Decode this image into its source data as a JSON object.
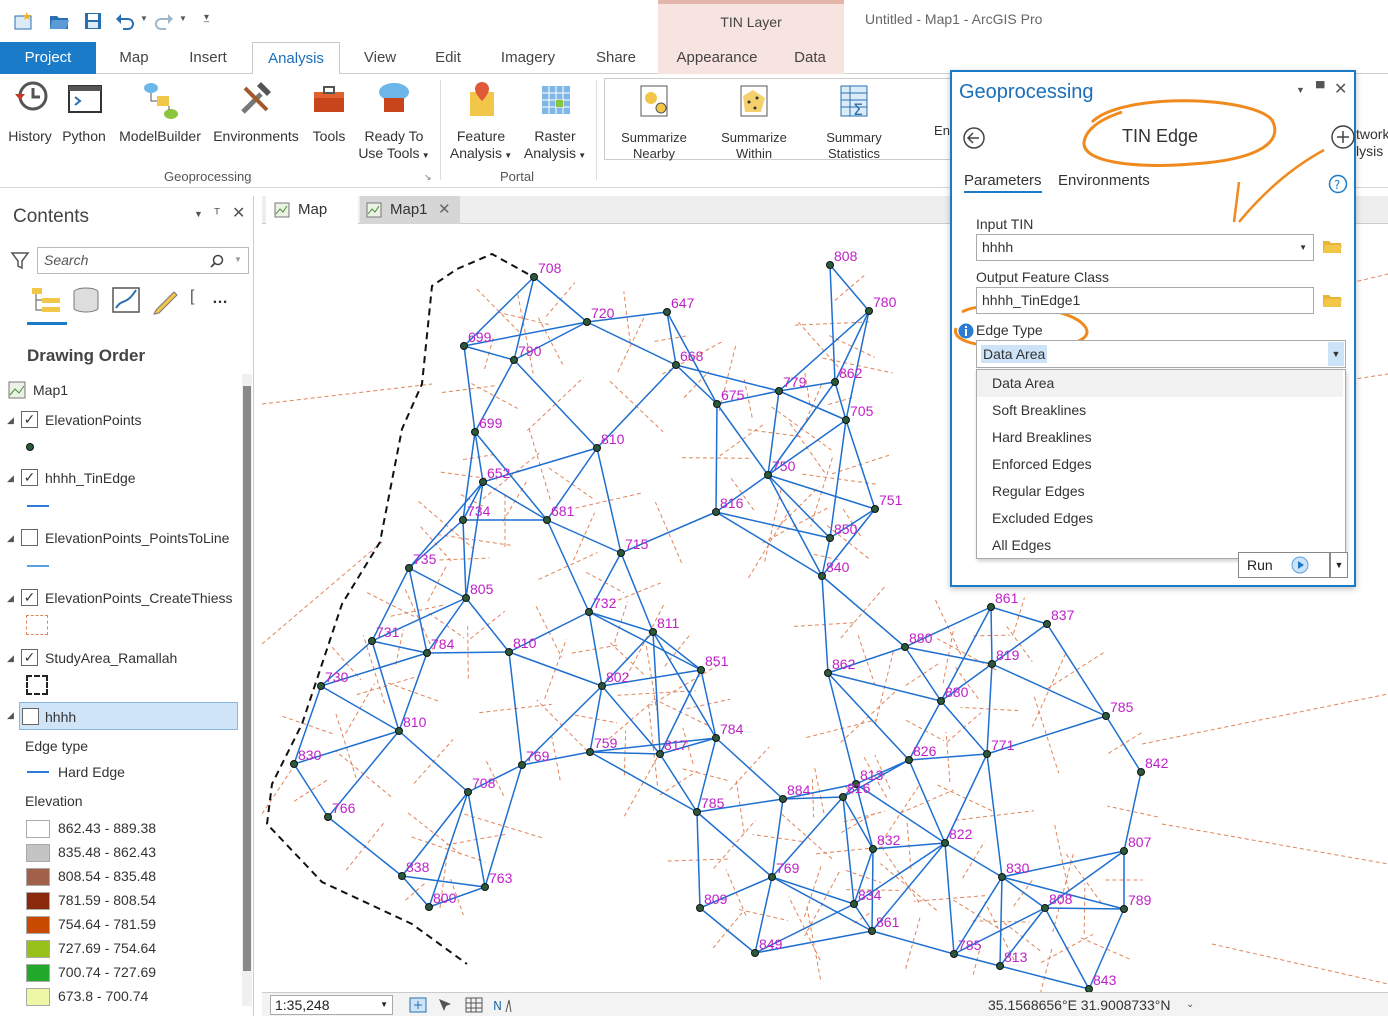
{
  "window": {
    "contextual_tab_header": "TIN Layer",
    "app_title": "Untitled - Map1 - ArcGIS Pro"
  },
  "tabs": {
    "project": "Project",
    "map": "Map",
    "insert": "Insert",
    "analysis": "Analysis",
    "view": "View",
    "edit": "Edit",
    "imagery": "Imagery",
    "share": "Share",
    "appearance": "Appearance",
    "data": "Data"
  },
  "ribbon": {
    "history": "History",
    "python": "Python",
    "modelbuilder": "ModelBuilder",
    "environments": "Environments",
    "tools": "Tools",
    "ready_to_use_1": "Ready To",
    "ready_to_use_2": "Use Tools",
    "geoprocessing_group": "Geoprocessing",
    "feature_analysis_1": "Feature",
    "feature_analysis_2": "Analysis",
    "raster_analysis_1": "Raster",
    "raster_analysis_2": "Analysis",
    "portal_group": "Portal",
    "summarize_nearby_1": "Summarize",
    "summarize_nearby_2": "Nearby",
    "summarize_within_1": "Summarize",
    "summarize_within_2": "Within",
    "summary_statistics_1": "Summary",
    "summary_statistics_2": "Statistics",
    "partial_en": "En",
    "partial_network_1": "twork",
    "partial_network_2": "lysis"
  },
  "contents": {
    "title": "Contents",
    "search_placeholder": "Search",
    "drawing_order": "Drawing Order",
    "map_name": "Map1",
    "layers": [
      {
        "name": "ElevationPoints",
        "checked": true
      },
      {
        "name": "hhhh_TinEdge",
        "checked": true
      },
      {
        "name": "ElevationPoints_PointsToLine",
        "checked": false
      },
      {
        "name": "ElevationPoints_CreateThiess",
        "checked": true
      },
      {
        "name": "StudyArea_Ramallah",
        "checked": true
      },
      {
        "name": "hhhh",
        "checked": false
      }
    ],
    "edge_type_heading": "Edge type",
    "hard_edge": "Hard Edge",
    "elevation_heading": "Elevation",
    "elevation_classes": [
      {
        "label": "862.43 - 889.38",
        "color": "#ffffff"
      },
      {
        "label": "835.48 - 862.43",
        "color": "#c4c4c4"
      },
      {
        "label": "808.54 - 835.48",
        "color": "#a0604a"
      },
      {
        "label": "781.59 - 808.54",
        "color": "#8a2a0a"
      },
      {
        "label": "754.64 - 781.59",
        "color": "#c84a00"
      },
      {
        "label": "727.69 - 754.64",
        "color": "#98c21a"
      },
      {
        "label": "700.74 - 727.69",
        "color": "#22a82a"
      },
      {
        "label": "673.8 - 700.74",
        "color": "#eef7a6"
      }
    ]
  },
  "map_tabs": {
    "map": "Map",
    "map1": "Map1"
  },
  "status": {
    "scale": "1:35,248",
    "coordinates": "35.1568656°E 31.9008733°N"
  },
  "geoprocessing": {
    "title": "Geoprocessing",
    "tool_name": "TIN Edge",
    "tab_parameters": "Parameters",
    "tab_environments": "Environments",
    "input_tin_label": "Input TIN",
    "input_tin_value": "hhhh",
    "output_label": "Output Feature Class",
    "output_value": "hhhh_TinEdge1",
    "edge_type_label": "Edge Type",
    "edge_type_value": "Data Area",
    "edge_type_options": [
      "Data Area",
      "Soft Breaklines",
      "Hard Breaklines",
      "Enforced Edges",
      "Regular Edges",
      "Excluded Edges",
      "All Edges"
    ],
    "run_label": "Run"
  },
  "map_labels": [
    "708",
    "720",
    "647",
    "699",
    "790",
    "668",
    "699",
    "810",
    "675",
    "652",
    "734",
    "681",
    "715",
    "816",
    "750",
    "735",
    "805",
    "732",
    "811",
    "731",
    "784",
    "810",
    "851",
    "802",
    "730",
    "810",
    "769",
    "759",
    "817",
    "784",
    "830",
    "708",
    "766",
    "785",
    "838",
    "763",
    "800",
    "809",
    "769",
    "813",
    "808",
    "780",
    "779",
    "862",
    "705",
    "751",
    "850",
    "840",
    "880",
    "862",
    "880",
    "861",
    "837",
    "826",
    "816",
    "884",
    "771",
    "822",
    "832",
    "834",
    "861",
    "830",
    "807",
    "808",
    "789",
    "785",
    "843",
    "849",
    "813",
    "842",
    "785",
    "819"
  ]
}
